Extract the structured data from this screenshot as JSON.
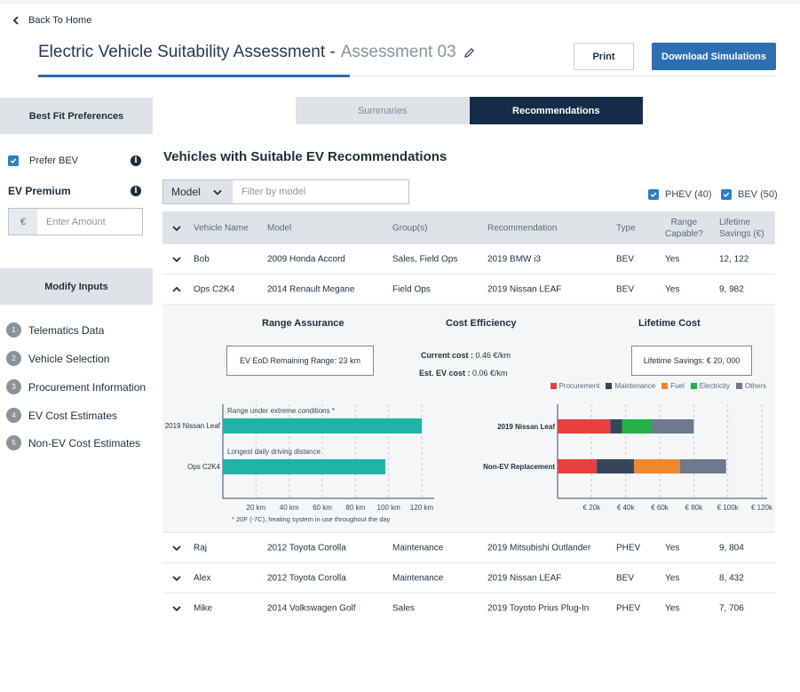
{
  "nav": {
    "back_label": "Back To Home"
  },
  "header": {
    "title": "Electric Vehicle Suitability Assessment -",
    "assessment": "Assessment 03",
    "print_label": "Print",
    "download_label": "Download Simulations"
  },
  "sidebar": {
    "best_fit_title": "Best Fit Preferences",
    "prefer_bev_label": "Prefer BEV",
    "ev_premium_label": "EV Premium",
    "currency_symbol": "€",
    "amount_placeholder": "Enter Amount",
    "modify_inputs_title": "Modify Inputs",
    "steps": [
      {
        "num": "1",
        "label": "Telematics Data"
      },
      {
        "num": "2",
        "label": "Vehicle Selection"
      },
      {
        "num": "3",
        "label": "Procurement Information"
      },
      {
        "num": "4",
        "label": "EV Cost Estimates"
      },
      {
        "num": "5",
        "label": "Non-EV Cost Estimates"
      }
    ]
  },
  "tabs": {
    "summaries": "Summaries",
    "recommendations": "Recommendations"
  },
  "main": {
    "section_title": "Vehicles with Suitable EV Recommendations",
    "filter_select": "Model",
    "filter_placeholder": "Filter by model",
    "phev_label": "PHEV (40)",
    "bev_label": "BEV (50)"
  },
  "table": {
    "headers": {
      "vehicle_name": "Vehicle Name",
      "model": "Model",
      "groups": "Group(s)",
      "recommendation": "Recommendation",
      "type": "Type",
      "range_1": "Range",
      "range_2": "Capable?",
      "savings_1": "Lifetime",
      "savings_2": "Savings (€)"
    },
    "rows": [
      {
        "name": "Bob",
        "model": "2009 Honda Accord",
        "groups": "Sales, Field Ops",
        "rec": "2019 BMW i3",
        "type": "BEV",
        "range": "Yes",
        "savings": "12, 122"
      },
      {
        "name": "Ops C2K4",
        "model": "2014 Renault Megane",
        "groups": "Field Ops",
        "rec": "2019 Nissan LEAF",
        "type": "BEV",
        "range": "Yes",
        "savings": "9, 982"
      },
      {
        "name": "Raj",
        "model": "2012 Toyota Corolla",
        "groups": "Maintenance",
        "rec": "2019 Mitsubishi Outlander",
        "type": "PHEV",
        "range": "Yes",
        "savings": "9, 804"
      },
      {
        "name": "Alex",
        "model": "2012 Toyota Corolla",
        "groups": "Maintenance",
        "rec": "2019 Nissan LEAF",
        "type": "BEV",
        "range": "Yes",
        "savings": "8, 432"
      },
      {
        "name": "Mike",
        "model": "2014 Volkswagen Golf",
        "groups": "Sales",
        "rec": "2019 Toyoto Prius Plug-In",
        "type": "PHEV",
        "range": "Yes",
        "savings": "7, 706"
      }
    ]
  },
  "details": {
    "range_title": "Range Assurance",
    "cost_title": "Cost Efficiency",
    "lifetime_title": "Lifetime Cost",
    "eod_label": "EV EoD Remaining Range: 23 km",
    "current_cost_label": "Current cost :",
    "current_cost_value": "0.46 €/km",
    "ev_cost_label": "Est. EV cost :",
    "ev_cost_value": "0.06 €/km",
    "lifetime_savings_label": "Lifetime Savings: € 20, 000",
    "footnote": "* 20F (-7C), heating system in use throughout the day"
  },
  "colors": {
    "procurement": "#e8403e",
    "maintenance": "#34465c",
    "fuel": "#f0872d",
    "electricity": "#25b04a",
    "others": "#6b7a8c",
    "range_bar": "#20b3a8"
  },
  "chart_data": [
    {
      "type": "bar",
      "orientation": "horizontal",
      "categories": [
        "2019 Nissan Leaf",
        "Ops C2K4"
      ],
      "values": [
        120,
        98
      ],
      "bar_labels": [
        "Range under extreme conditions *",
        "Longest daily driving distance"
      ],
      "x_ticks": [
        "20 km",
        "40 km",
        "60 km",
        "80 km",
        "100 km",
        "120 km"
      ],
      "xlim": [
        0,
        120
      ]
    },
    {
      "type": "bar",
      "orientation": "horizontal",
      "stacked": true,
      "categories": [
        "2019 Nissan Leaf",
        "Non-EV Replacement"
      ],
      "legend": [
        "Procurement",
        "Maintenance",
        "Fuel",
        "Electricity",
        "Others"
      ],
      "series": [
        {
          "name": "Procurement",
          "values": [
            31000,
            23000
          ]
        },
        {
          "name": "Maintenance",
          "values": [
            7000,
            22000
          ]
        },
        {
          "name": "Fuel",
          "values": [
            0,
            27000
          ]
        },
        {
          "name": "Electricity",
          "values": [
            17000,
            0
          ]
        },
        {
          "name": "Others",
          "values": [
            25000,
            27000
          ]
        }
      ],
      "x_ticks": [
        "€ 20k",
        "€ 40k",
        "€ 60k",
        "€ 80k",
        "€ 100k",
        "€ 120k"
      ],
      "xlim": [
        0,
        120000
      ]
    }
  ]
}
